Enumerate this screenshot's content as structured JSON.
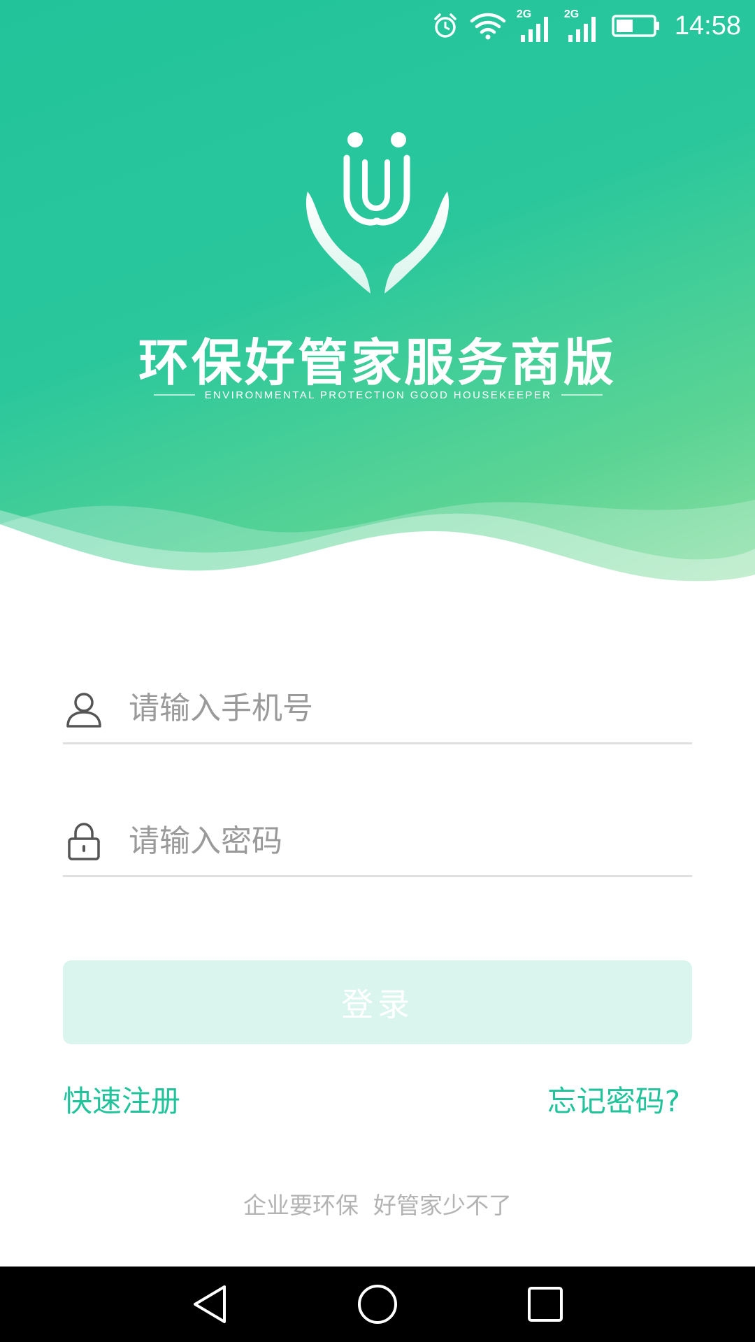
{
  "status_bar": {
    "time": "14:58",
    "network_1": "2G",
    "network_2": "2G",
    "icons": [
      "alarm-icon",
      "wifi-icon",
      "signal-icon",
      "signal-icon",
      "battery-icon"
    ],
    "battery_level": 0.45
  },
  "header": {
    "app_title": "环保好管家服务商版",
    "subtitle": "ENVIRONMENTAL PROTECTION GOOD HOUSEKEEPER",
    "logo_icon": "hands-logo-icon"
  },
  "form": {
    "phone_placeholder": "请输入手机号",
    "phone_value": "",
    "phone_icon": "user-icon",
    "password_placeholder": "请输入密码",
    "password_value": "",
    "password_icon": "lock-icon",
    "login_label": "登录"
  },
  "links": {
    "register": "快速注册",
    "forgot": "忘记密码?"
  },
  "footer": {
    "slogan": "企业要环保  好管家少不了"
  },
  "nav_bar": {
    "icons": [
      "back-icon",
      "home-icon",
      "recents-icon"
    ]
  },
  "colors": {
    "accent": "#22c39b",
    "button_disabled": "#d9f5ee",
    "placeholder": "#9a9a9a",
    "slogan": "#b3b3b3"
  }
}
